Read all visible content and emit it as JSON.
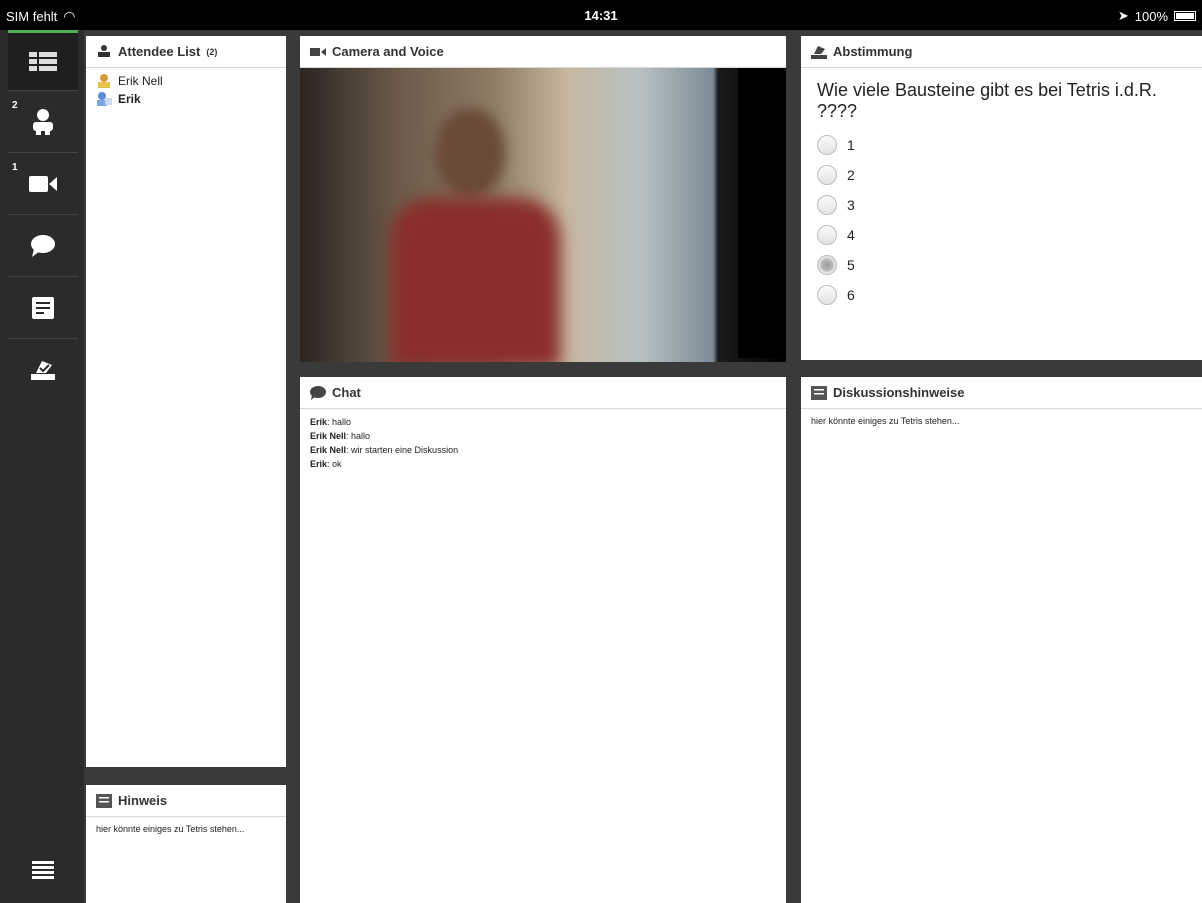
{
  "status_bar": {
    "carrier": "SIM fehlt",
    "time": "14:31",
    "battery": "100%"
  },
  "sidebar": {
    "items": [
      {
        "name": "layout",
        "badge": ""
      },
      {
        "name": "attendees",
        "badge": "2"
      },
      {
        "name": "camera",
        "badge": "1"
      },
      {
        "name": "chat",
        "badge": ""
      },
      {
        "name": "notes",
        "badge": ""
      },
      {
        "name": "poll",
        "badge": ""
      }
    ]
  },
  "attendee_panel": {
    "title": "Attendee List",
    "count": "(2)",
    "attendees": [
      {
        "name": "Erik Nell"
      },
      {
        "name": "Erik"
      }
    ]
  },
  "camera_panel": {
    "title": "Camera and Voice"
  },
  "poll_panel": {
    "title": "Abstimmung",
    "question": "Wie viele Bausteine gibt es bei Tetris i.d.R. ????",
    "options": [
      "1",
      "2",
      "3",
      "4",
      "5",
      "6"
    ],
    "selected": "5"
  },
  "chat_panel": {
    "title": "Chat",
    "messages": [
      {
        "sender": "Erik",
        "text": ": hallo"
      },
      {
        "sender": "Erik Nell",
        "text": ": hallo"
      },
      {
        "sender": "Erik Nell",
        "text": ": wir starten eine Diskussion"
      },
      {
        "sender": "Erik",
        "text": ": ok"
      }
    ]
  },
  "discussion_panel": {
    "title": "Diskussionshinweise",
    "text": "hier könnte einiges zu Tetris stehen..."
  },
  "hint_panel": {
    "title": "Hinweis",
    "text": "hier könnte einiges zu Tetris stehen..."
  },
  "colors": {
    "accent": "#4caf50",
    "sidebar": "#2b2b2b",
    "background": "#3a3a3a"
  }
}
